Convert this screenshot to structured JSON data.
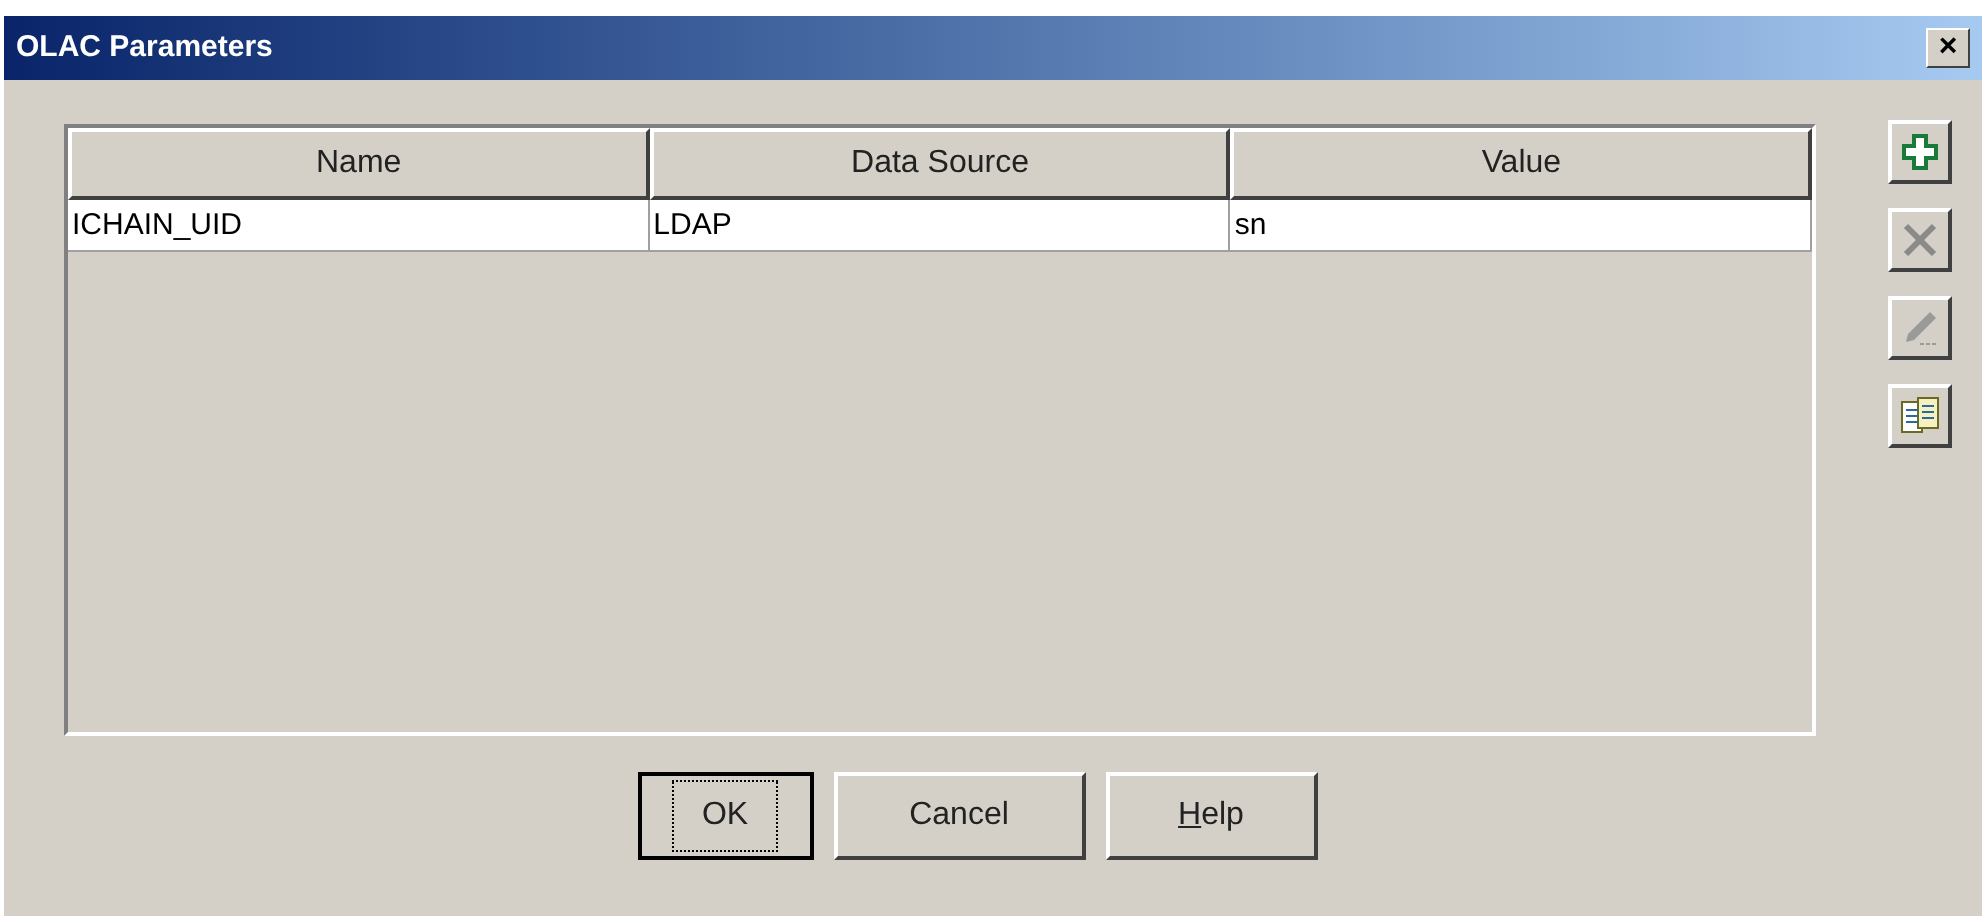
{
  "window": {
    "title": "OLAC Parameters",
    "close": "×"
  },
  "table": {
    "columns": [
      "Name",
      "Data Source",
      "Value"
    ],
    "rows": [
      {
        "cells": [
          "ICHAIN_UID",
          "LDAP",
          "sn"
        ],
        "selected": false
      }
    ]
  },
  "side_buttons": [
    {
      "kind": "add",
      "disabled": false
    },
    {
      "kind": "delete",
      "disabled": true
    },
    {
      "kind": "edit",
      "disabled": true
    },
    {
      "kind": "copy",
      "disabled": false
    }
  ],
  "buttons": [
    {
      "label": "OK",
      "default": true,
      "mnemonic": false
    },
    {
      "label": "Cancel",
      "default": false,
      "mnemonic": false
    },
    {
      "label": "Help",
      "default": false,
      "mnemonic": true
    }
  ]
}
